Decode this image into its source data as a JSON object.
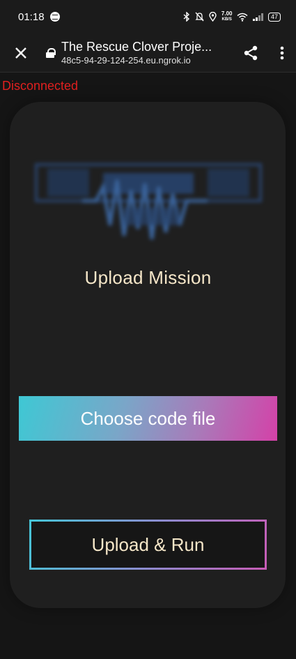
{
  "status_bar": {
    "time": "01:18",
    "network_speed": "7.00",
    "network_speed_unit": "KB/S",
    "battery": "47",
    "icons": [
      "spotify-icon",
      "bluetooth-icon",
      "mute-icon",
      "location-icon",
      "wifi-icon",
      "signal-icon",
      "battery-icon"
    ]
  },
  "browser": {
    "page_title": "The Rescue Clover Proje...",
    "url": "48c5-94-29-124-254.eu.ngrok.io",
    "icons": [
      "close-icon",
      "lock-icon",
      "share-icon",
      "more-vert-icon"
    ]
  },
  "app": {
    "connection_status": "Disconnected",
    "connection_color": "#e0201f",
    "title": "Upload Mission",
    "choose_label": "Choose code file",
    "upload_label": "Upload & Run",
    "accent_cyan": "#3ec8d4",
    "accent_magenta": "#d441a8"
  }
}
